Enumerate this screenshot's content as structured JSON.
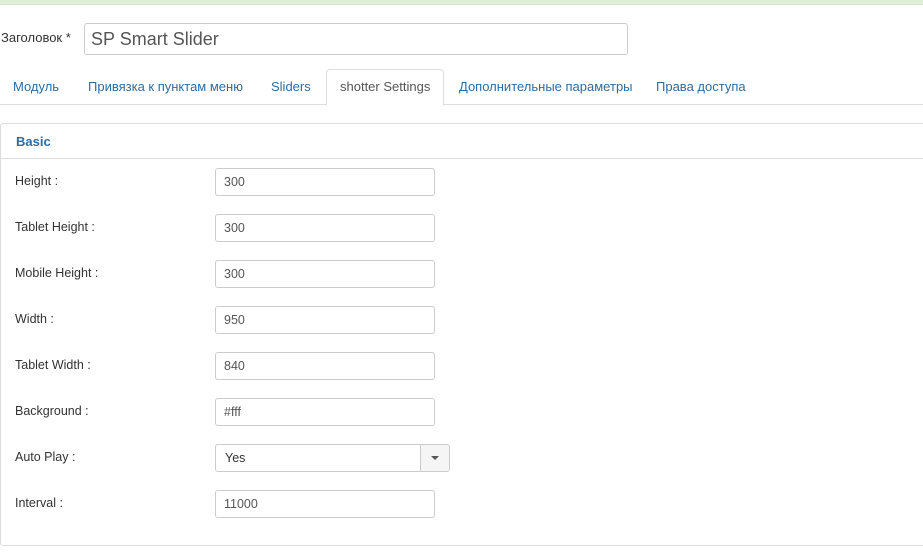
{
  "title": {
    "label": "Заголовок *",
    "value": "SP Smart Slider"
  },
  "tabs": [
    {
      "label": "Модуль"
    },
    {
      "label": "Привязка к пунктам меню"
    },
    {
      "label": "Sliders"
    },
    {
      "label": "shotter Settings"
    },
    {
      "label": "Дополнительные параметры"
    },
    {
      "label": "Права доступа"
    }
  ],
  "active_tab": "shotter Settings",
  "panel": {
    "title": "Basic"
  },
  "fields": [
    {
      "label": "Height :",
      "value": "300"
    },
    {
      "label": "Tablet Height :",
      "value": "300"
    },
    {
      "label": "Mobile Height :",
      "value": "300"
    },
    {
      "label": "Width :",
      "value": "950"
    },
    {
      "label": "Tablet Width :",
      "value": "840"
    },
    {
      "label": "Background :",
      "value": "#fff"
    },
    {
      "label": "Auto Play :",
      "value": "Yes"
    },
    {
      "label": "Interval :",
      "value": "11000"
    }
  ],
  "icons": {
    "select_toggle": "chevron-down-icon"
  },
  "colors": {
    "link": "#2d6ca2",
    "success_bar": "#dff0d8",
    "border": "#dddddd"
  }
}
